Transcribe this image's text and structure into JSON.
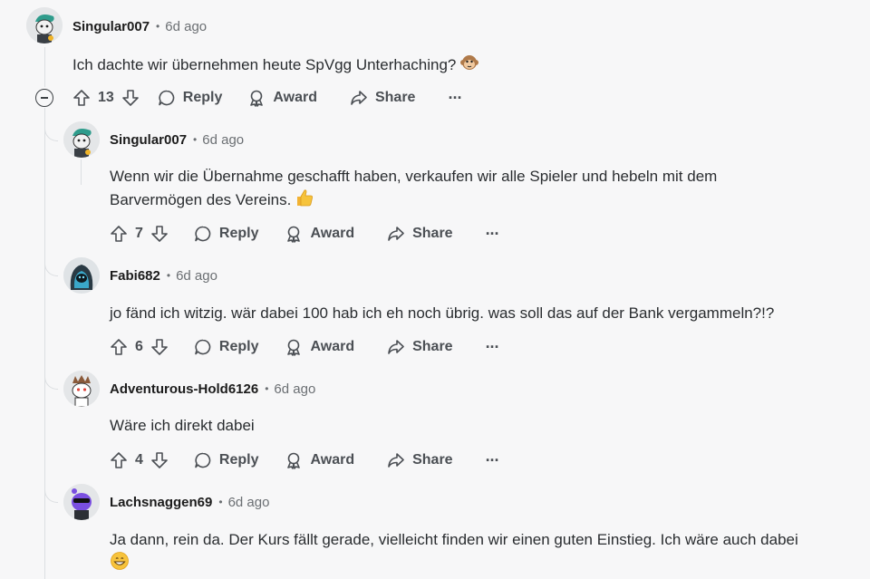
{
  "comments": [
    {
      "author": "Singular007",
      "time": "6d ago",
      "body": "Ich dachte wir übernehmen heute SpVgg Unterhaching?",
      "votes": "13",
      "reply": "Reply",
      "award": "Award",
      "share": "Share",
      "emoji": "monkey-face-icon"
    },
    {
      "author": "Singular007",
      "time": "6d ago",
      "body": "Wenn wir die Übernahme geschafft haben, verkaufen wir alle Spieler und hebeln mit dem Barvermögen des Vereins.",
      "votes": "7",
      "reply": "Reply",
      "award": "Award",
      "share": "Share",
      "emoji": "thumbs-up-icon"
    },
    {
      "author": "Fabi682",
      "time": "6d ago",
      "body": "jo fänd ich witzig. wär dabei 100 hab ich eh noch übrig. was soll das auf der Bank vergammeln?!?",
      "votes": "6",
      "reply": "Reply",
      "award": "Award",
      "share": "Share"
    },
    {
      "author": "Adventurous-Hold6126",
      "time": "6d ago",
      "body": "Wäre ich direkt dabei",
      "votes": "4",
      "reply": "Reply",
      "award": "Award",
      "share": "Share"
    },
    {
      "author": "Lachsnaggen69",
      "time": "6d ago",
      "body": "Ja dann, rein da. Der Kurs fällt gerade, vielleicht finden wir einen guten Einstieg. Ich wäre auch dabei",
      "emoji": "grinning-face-icon"
    }
  ],
  "dot": "•",
  "more": "···",
  "colors": {
    "accent_text": "#4b4f54",
    "muted": "#6b6f73",
    "thread_line": "#dcdfe2"
  }
}
